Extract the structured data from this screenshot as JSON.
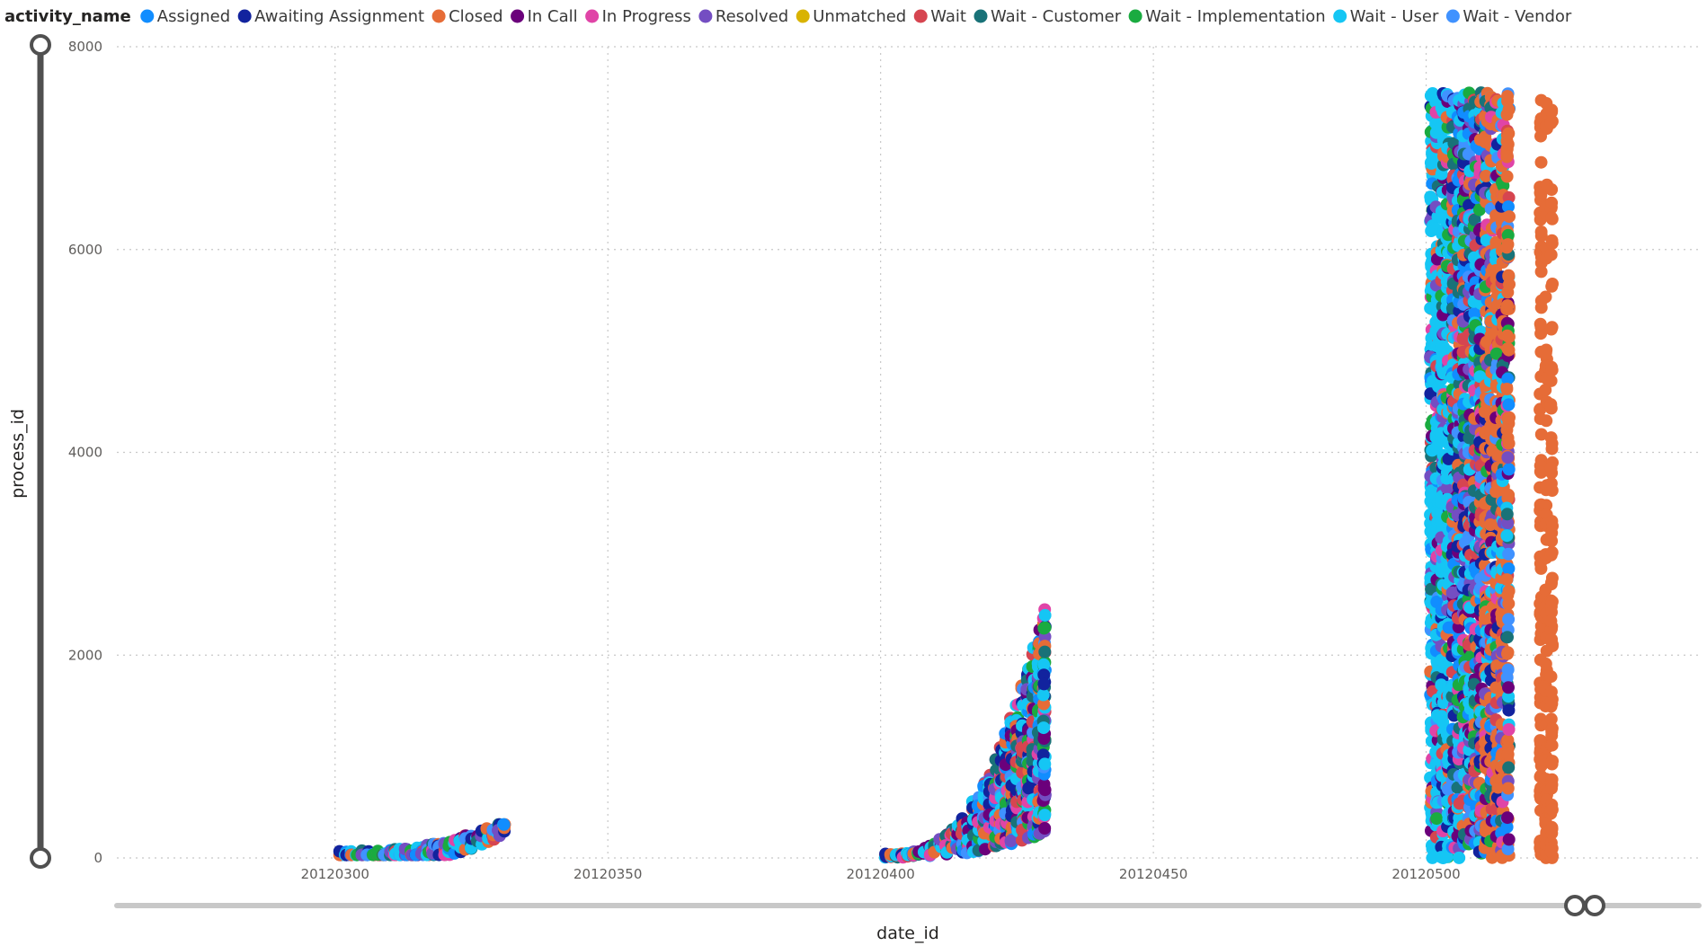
{
  "chart_data": {
    "type": "scatter",
    "title": "",
    "legend": {
      "title": "activity_name",
      "placement": "top-left",
      "items": [
        {
          "name": "Assigned",
          "color": "#118DFF"
        },
        {
          "name": "Awaiting Assignment",
          "color": "#12239E"
        },
        {
          "name": "Closed",
          "color": "#E66C37"
        },
        {
          "name": "In Call",
          "color": "#6B007B"
        },
        {
          "name": "In Progress",
          "color": "#E044A7"
        },
        {
          "name": "Resolved",
          "color": "#744EC2"
        },
        {
          "name": "Unmatched",
          "color": "#D9B300"
        },
        {
          "name": "Wait",
          "color": "#D64550"
        },
        {
          "name": "Wait - Customer",
          "color": "#197278"
        },
        {
          "name": "Wait - Implementation",
          "color": "#1AAB40"
        },
        {
          "name": "Wait - User",
          "color": "#15C6F4"
        },
        {
          "name": "Wait - Vendor",
          "color": "#4092FF"
        }
      ]
    },
    "xlabel": "date_id",
    "ylabel": "process_id",
    "xlim": [
      20120260,
      20120550
    ],
    "ylim": [
      0,
      8000
    ],
    "xticks": [
      20120300,
      20120350,
      20120400,
      20120450,
      20120500
    ],
    "yticks": [
      0,
      2000,
      4000,
      6000,
      8000
    ],
    "grid": true,
    "clusters": [
      {
        "date_from": 20120301,
        "date_to": 20120331,
        "process_min": 30,
        "process_max": 330,
        "note_shape": "rising"
      },
      {
        "date_from": 20120401,
        "date_to": 20120430,
        "process_min": 0,
        "process_max": 2450,
        "note_shape": "rising"
      },
      {
        "date_from": 20120501,
        "date_to": 20120515,
        "process_min": 0,
        "process_max": 7550,
        "note_shape": "dense"
      },
      {
        "date_from": 20120521,
        "date_to": 20120523,
        "process_min": 0,
        "process_max": 7480,
        "note_shape": "closed-only"
      }
    ]
  },
  "slicers": {
    "y_range": [
      0,
      8000
    ],
    "x_range_handle": "end"
  }
}
